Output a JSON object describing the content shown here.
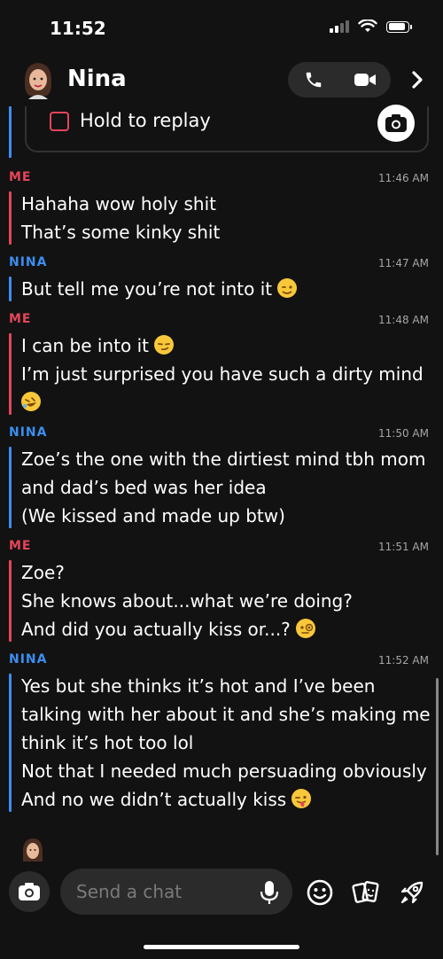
{
  "status_bar": {
    "time": "11:52"
  },
  "header": {
    "contact_name": "Nina"
  },
  "replay": {
    "label": "Hold to replay"
  },
  "messages": [
    {
      "sender": "ME",
      "time": "11:46 AM",
      "lines": [
        "Hahaha wow holy shit",
        "That’s some kinky shit"
      ]
    },
    {
      "sender": "NINA",
      "time": "11:47 AM",
      "lines": [
        "But tell me you’re not into it"
      ]
    },
    {
      "sender": "ME",
      "time": "11:48 AM",
      "lines": [
        "I can be into it",
        "I’m just surprised you have such a dirty mind",
        ""
      ]
    },
    {
      "sender": "NINA",
      "time": "11:50 AM",
      "lines": [
        "Zoe’s the one with the dirtiest mind tbh mom",
        "and dad’s bed was her idea",
        "(We kissed and made up btw)"
      ]
    },
    {
      "sender": "ME",
      "time": "11:51 AM",
      "lines": [
        "Zoe?",
        "She knows about...what we’re doing?",
        "And did you actually kiss or...?"
      ]
    },
    {
      "sender": "NINA",
      "time": "11:52 AM",
      "lines": [
        "Yes but she thinks it’s hot and I’ve been",
        "talking with her about it and she’s making me",
        "think it’s hot too lol",
        "Not that I needed much persuading obviously",
        "And no we didn’t actually kiss"
      ]
    }
  ],
  "composer": {
    "placeholder": "Send a chat"
  },
  "icons": {
    "header": [
      "bitmoji-avatar-icon",
      "phone-icon",
      "video-icon",
      "chevron-right-icon"
    ],
    "composer": [
      "camera-icon",
      "microphone-icon",
      "smiley-icon",
      "sticker-icon",
      "rocket-icon"
    ],
    "emojis": [
      "winking-face",
      "smirking-face",
      "rolling-laughing-face",
      "face-with-monocle",
      "face-with-tongue"
    ]
  },
  "colors": {
    "me": "#e5455a",
    "nina": "#3b8ef0",
    "background": "#121212"
  }
}
